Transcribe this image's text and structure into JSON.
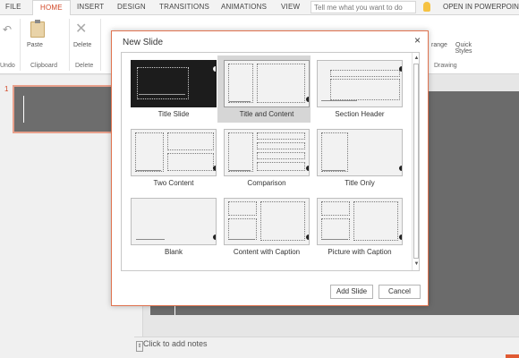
{
  "ribbon": {
    "tabs": [
      "FILE",
      "HOME",
      "INSERT",
      "DESIGN",
      "TRANSITIONS",
      "ANIMATIONS",
      "VIEW"
    ],
    "active_tab": "HOME",
    "tell_me_placeholder": "Tell me what you want to do",
    "open_in_powerpoint": "OPEN IN POWERPOIN",
    "paste_label": "Paste",
    "delete_label": "Delete",
    "arrange_label": "range",
    "quick_styles_label": "Quick Styles",
    "groups": {
      "undo": "Undo",
      "clipboard": "Clipboard",
      "delete": "Delete",
      "drawing": "Drawing"
    }
  },
  "thumbnails": {
    "slide_number": "1"
  },
  "notes": {
    "placeholder": "Click to add notes"
  },
  "dialog": {
    "title": "New Slide",
    "close": "×",
    "layouts": [
      {
        "name": "Title Slide",
        "selected": false
      },
      {
        "name": "Title and Content",
        "selected": true
      },
      {
        "name": "Section Header",
        "selected": false
      },
      {
        "name": "Two Content",
        "selected": false
      },
      {
        "name": "Comparison",
        "selected": false
      },
      {
        "name": "Title Only",
        "selected": false
      },
      {
        "name": "Blank",
        "selected": false
      },
      {
        "name": "Content with Caption",
        "selected": false
      },
      {
        "name": "Picture with Caption",
        "selected": false
      }
    ],
    "add_button": "Add Slide",
    "cancel_button": "Cancel"
  },
  "colors": {
    "accent": "#d24726",
    "dialog_border": "#e0734f",
    "selected_layout": "#d6d6d6"
  }
}
